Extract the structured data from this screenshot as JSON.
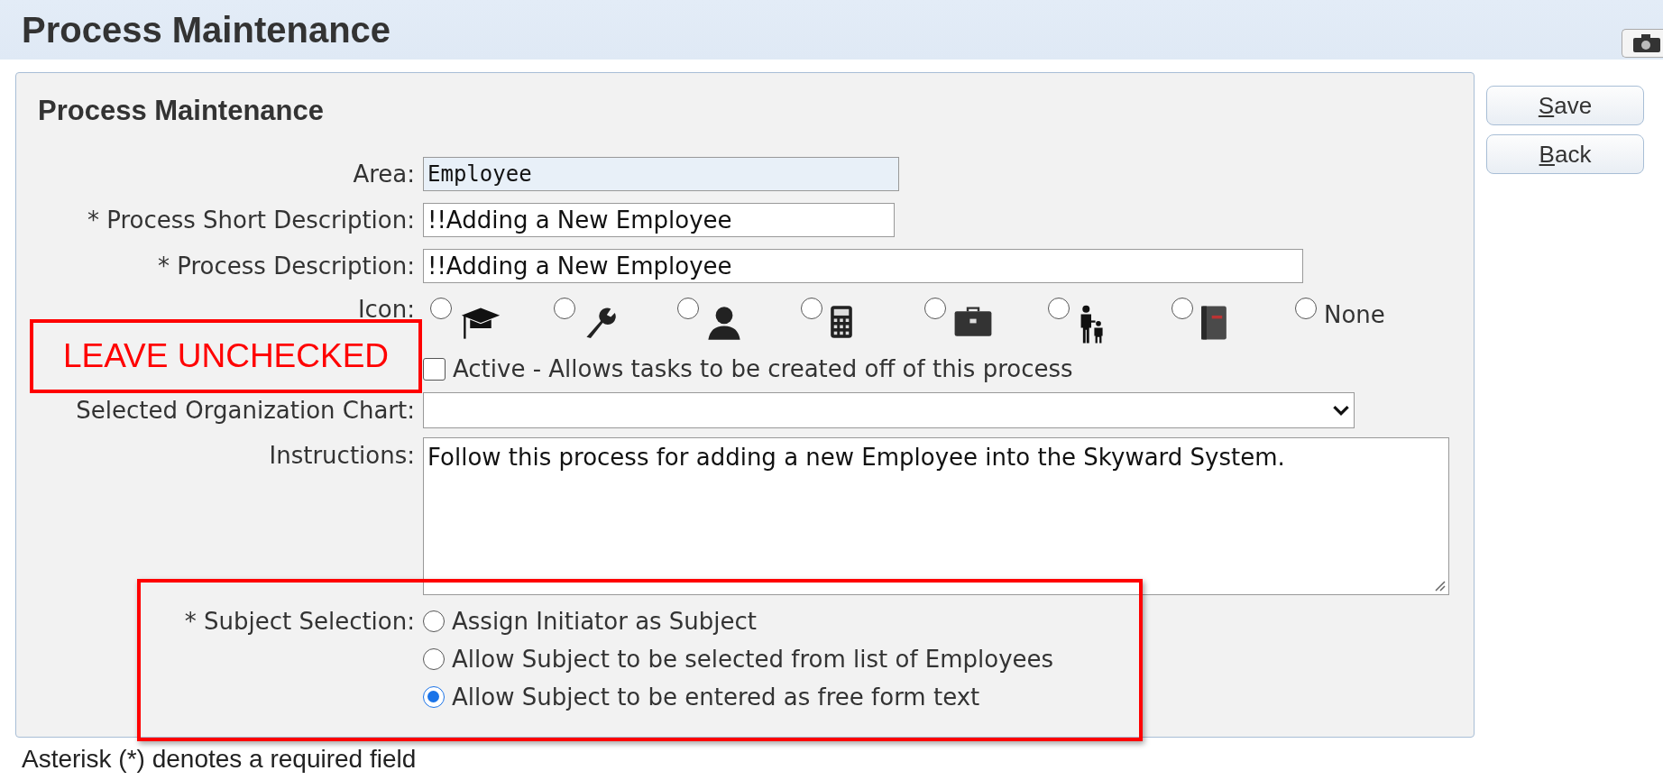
{
  "header": {
    "title": "Process Maintenance"
  },
  "panel": {
    "title": "Process Maintenance",
    "area": {
      "label": "Area:",
      "value": "Employee"
    },
    "short_description": {
      "label": "* Process Short Description:",
      "value": "!!Adding a New Employee"
    },
    "description": {
      "label": "* Process Description:",
      "value": "!!Adding a New Employee"
    },
    "icon": {
      "label": "Icon:",
      "options": [
        {
          "selected": false
        },
        {
          "selected": false
        },
        {
          "selected": false
        },
        {
          "selected": false
        },
        {
          "selected": false
        },
        {
          "selected": false
        },
        {
          "selected": false
        },
        {
          "label": "None",
          "selected": false
        }
      ]
    },
    "active": {
      "label": "Active - Allows tasks to be created off of this process",
      "checked": false
    },
    "org_chart": {
      "label": "Selected Organization Chart:"
    },
    "instructions": {
      "label": "Instructions:",
      "value": "Follow this process for adding a new Employee into the Skyward System."
    },
    "subject_selection": {
      "label": "* Subject Selection:",
      "options": [
        {
          "label": "Assign Initiator as Subject",
          "selected": false
        },
        {
          "label": "Allow Subject to be selected from list of Employees",
          "selected": false
        },
        {
          "label": "Allow Subject to be entered as free form text",
          "selected": true
        }
      ]
    }
  },
  "buttons": [
    {
      "label": "Save"
    },
    {
      "label": "Back"
    }
  ],
  "footnote": "Asterisk (*) denotes a required field",
  "annotations": [
    {
      "kind": "callout",
      "label": "LEAVE UNCHECKED"
    },
    {
      "kind": "frame"
    }
  ]
}
